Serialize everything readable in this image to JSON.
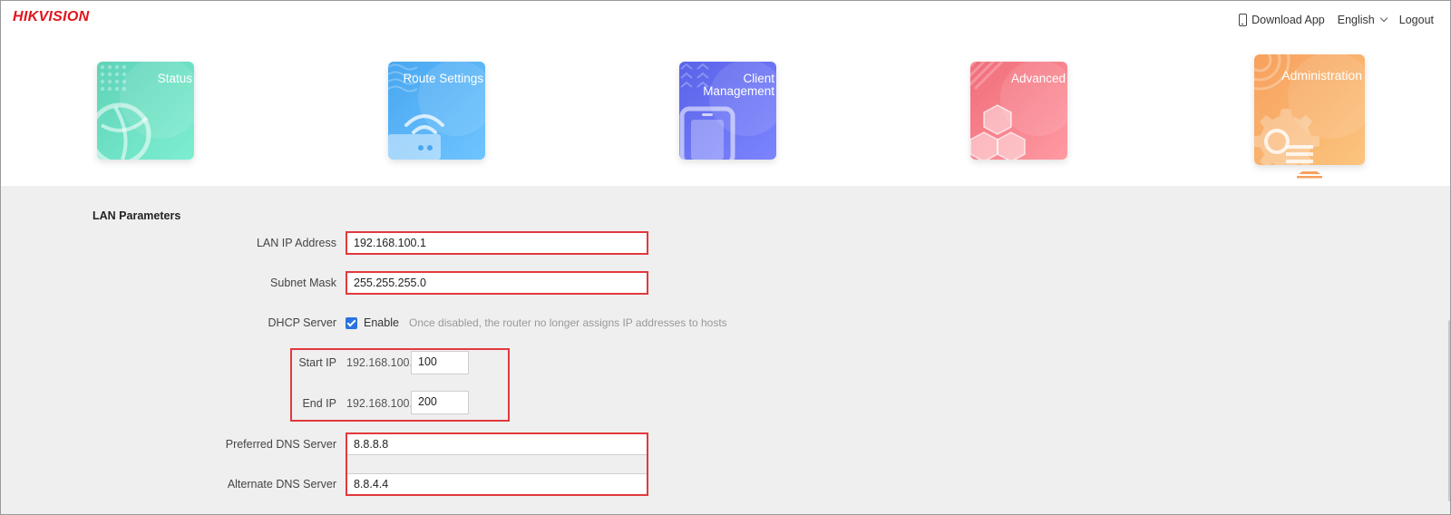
{
  "brand": {
    "logo_text": "HIKVISION",
    "color": "#e1141c"
  },
  "topnav": {
    "download_app": "Download App",
    "language": "English",
    "logout": "Logout"
  },
  "modules": [
    {
      "label": "Status",
      "icon": "globe-icon"
    },
    {
      "label": "Route Settings",
      "icon": "wifi-router-icon"
    },
    {
      "label": "Client Management",
      "label_line1": "Client",
      "label_line2": "Management",
      "icon": "phone-device-icon"
    },
    {
      "label": "Advanced",
      "icon": "cubes-icon"
    },
    {
      "label": "Administration",
      "icon": "gear-settings-icon",
      "active": true
    }
  ],
  "lan": {
    "section_title": "LAN Parameters",
    "lan_ip_label": "LAN IP Address",
    "lan_ip_value": "192.168.100.1",
    "subnet_label": "Subnet Mask",
    "subnet_value": "255.255.255.0",
    "dhcp_label": "DHCP Server",
    "dhcp_enable_label": "Enable",
    "dhcp_enabled": true,
    "dhcp_hint": "Once disabled, the router no longer assigns IP addresses to hosts",
    "start_ip_label": "Start IP",
    "start_ip_prefix": "192.168.100.",
    "start_ip_value": "100",
    "end_ip_label": "End IP",
    "end_ip_prefix": "192.168.100.",
    "end_ip_value": "200",
    "pref_dns_label": "Preferred DNS Server",
    "pref_dns_value": "8.8.8.8",
    "alt_dns_label": "Alternate DNS Server",
    "alt_dns_value": "8.8.4.4"
  },
  "colors": {
    "highlight": "#e3393c",
    "checkbox": "#2a72e0",
    "content_bg": "#efefef"
  }
}
